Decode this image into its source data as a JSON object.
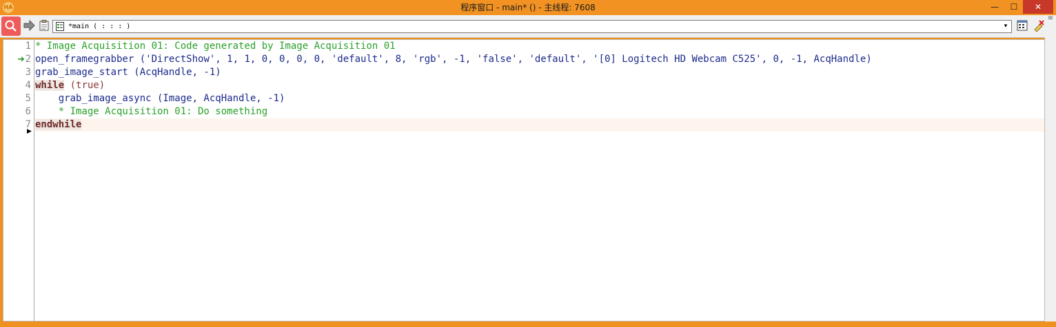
{
  "window": {
    "title": "程序窗口 - main* () - 主线程: 7608",
    "icon_text": "HA",
    "minimize_glyph": "—",
    "maximize_glyph": "☐",
    "close_glyph": "✕",
    "accent_color": "#f19223"
  },
  "toolbar": {
    "procedure_combo_value": "*main ( : : : )",
    "combo_arrow_glyph": "▾",
    "icons": [
      "search-icon",
      "forward-arrow-icon",
      "clipboard-icon",
      "procedure-icon",
      "edit-procedure-icon",
      "delete-procedure-icon"
    ]
  },
  "editor": {
    "lines": [
      {
        "number": "1",
        "text": "* Image Acquisition 01: Code generated by Image Acquisition 01"
      },
      {
        "number": "2",
        "op": "open_framegrabber",
        "args": " ('DirectShow', 1, 1, 0, 0, 0, 0, 'default', 8, 'rgb', -1, 'false', 'default', '[0] Logitech HD Webcam C525', 0, -1, AcqHandle)"
      },
      {
        "number": "3",
        "op": "grab_image_start",
        "args": " (AcqHandle, -1)"
      },
      {
        "number": "4",
        "kw": "while",
        "args": " (true)"
      },
      {
        "number": "5",
        "indent": "    ",
        "op": "grab_image_async",
        "args": " (Image, AcqHandle, -1)"
      },
      {
        "number": "6",
        "text": "    * Image Acquisition 01: Do something"
      },
      {
        "number": "7",
        "kw": "endwhile"
      }
    ],
    "pc_marker_glyph": "➜",
    "insert_cursor_glyph": "▶"
  },
  "scrollbar": {
    "grip_glyph": "≡"
  }
}
